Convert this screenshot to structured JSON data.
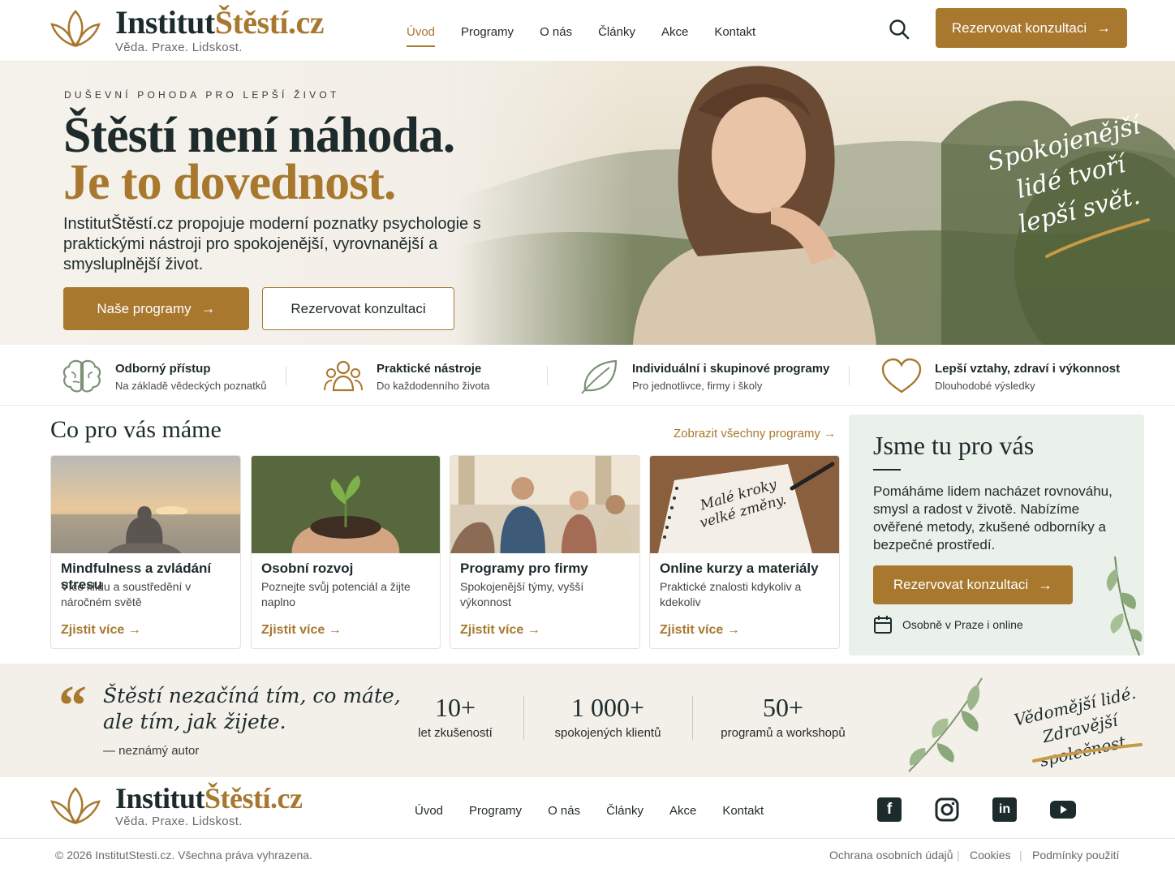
{
  "brand": {
    "name_part1": "Institut",
    "name_part2": "Štěstí.cz",
    "tagline": "Věda. Praxe. Lidskost."
  },
  "nav": {
    "items": [
      "Úvod",
      "Programy",
      "O nás",
      "Články",
      "Akce",
      "Kontakt"
    ],
    "active": "Úvod"
  },
  "header": {
    "search_icon": "search-icon",
    "cta_label": "Rezervovat konzultaci"
  },
  "hero": {
    "eyebrow": "DUŠEVNÍ POHODA PRO LEPŠÍ ŽIVOT",
    "title_line1": "Štěstí není náhoda.",
    "title_line2": "Je to dovednost.",
    "description": "InstitutŠtěstí.cz propojuje moderní poznatky psychologie s praktickými nástroji pro spokojenější, vyrovnanější a smysluplnější život.",
    "primary_button": "Naše programy",
    "secondary_button": "Rezervovat konzultaci",
    "script_text": "Spokojenější lidé tvoří lepší svět."
  },
  "features": [
    {
      "icon": "brain-icon",
      "title": "Odborný přístup",
      "subtitle": "Na základě vědeckých poznatků"
    },
    {
      "icon": "people-icon",
      "title": "Praktické nástroje",
      "subtitle": "Do každodenního života"
    },
    {
      "icon": "leaf-icon",
      "title": "Individuální i skupinové programy",
      "subtitle": "Pro jednotlivce, firmy i školy"
    },
    {
      "icon": "heart-icon",
      "title": "Lepší vztahy, zdraví i výkonnost",
      "subtitle": "Dlouhodobé výsledky"
    }
  ],
  "programs": {
    "title": "Co pro vás máme",
    "see_all": "Zobrazit všechny programy",
    "cards": [
      {
        "title": "Mindfulness a zvládání stresu",
        "desc": "Více klidu a soustředění v náročném světě",
        "link": "Zjistit více"
      },
      {
        "title": "Osobní rozvoj",
        "desc": "Poznejte svůj potenciál a žijte naplno",
        "link": "Zjistit více"
      },
      {
        "title": "Programy pro firmy",
        "desc": "Spokojenější týmy, vyšší výkonnost",
        "link": "Zjistit více"
      },
      {
        "title": "Online kurzy a materiály",
        "desc": "Praktické znalosti kdykoliv a kdekoliv",
        "link": "Zjistit více"
      }
    ],
    "notebook_text": "Malé kroky velké změny."
  },
  "side": {
    "title": "Jsme tu pro vás",
    "desc": "Pomáháme lidem nacházet rovnováhu, smysl a radost v životě. Nabízíme ověřené metody, zkušené odborníky a bezpečné prostředí.",
    "button": "Rezervovat konzultaci",
    "info": "Osobně v Praze i online"
  },
  "quote": {
    "text_line1": "Štěstí nezačíná tím, co máte,",
    "text_line2": "ale tím, jak žijete.",
    "author": "— neznámý autor"
  },
  "stats": [
    {
      "value": "10+",
      "label": "let zkušeností"
    },
    {
      "value": "1 000+",
      "label": "spokojených klientů"
    },
    {
      "value": "50+",
      "label": "programů a workshopů"
    }
  ],
  "band_script": "Vědomější lidé. Zdravější společnost.",
  "footer": {
    "nav": [
      "Úvod",
      "Programy",
      "O nás",
      "Články",
      "Akce",
      "Kontakt"
    ],
    "social": [
      "facebook-icon",
      "instagram-icon",
      "linkedin-icon",
      "youtube-icon"
    ],
    "copyright": "© 2026 InstitutStesti.cz. Všechna práva vyhrazena.",
    "links": [
      "Ochrana osobních údajů",
      "Cookies",
      "Podmínky použití"
    ]
  },
  "colors": {
    "accent": "#a8782f",
    "dark": "#1d2b2c",
    "side_bg": "#eaf0ea",
    "band_bg": "#f3f0ea"
  }
}
